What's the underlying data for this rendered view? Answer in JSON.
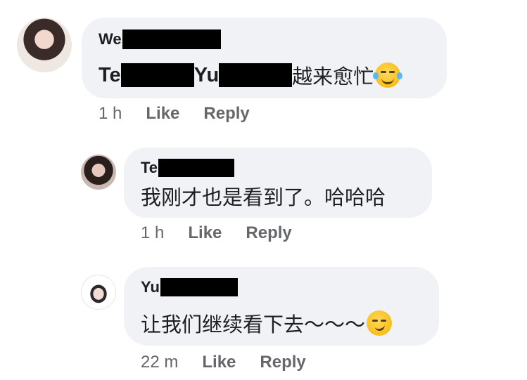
{
  "comments": [
    {
      "author_visible": "We",
      "text_prefix": "Te",
      "text_mid": "Yu",
      "text_suffix": "越来愈忙",
      "emoji": "laughing-tears-emoji",
      "time": "1 h",
      "like_label": "Like",
      "reply_label": "Reply"
    },
    {
      "author_visible": "Te",
      "text": "我刚才也是看到了。哈哈哈",
      "time": "1 h",
      "like_label": "Like",
      "reply_label": "Reply"
    },
    {
      "author_visible": "Yu",
      "text": "让我们继续看下去～～～",
      "emoji": "smirk-emoji",
      "time": "22 m",
      "like_label": "Like",
      "reply_label": "Reply"
    }
  ],
  "colors": {
    "bubble": "#f0f2f5",
    "text": "#1c1e21",
    "meta": "#65676b",
    "redaction": "#000000"
  }
}
